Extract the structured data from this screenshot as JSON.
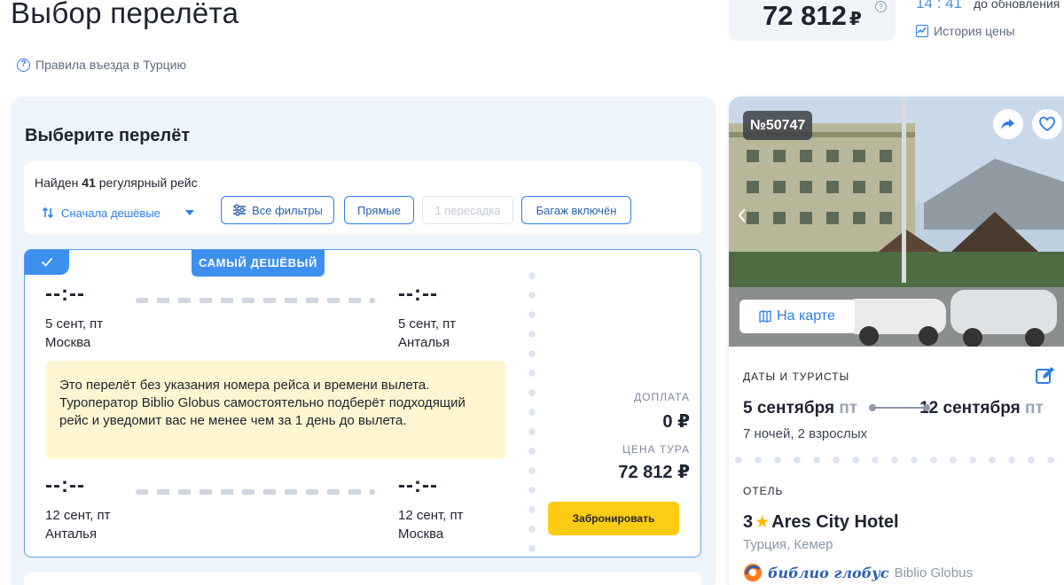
{
  "header": {
    "title": "Выбор перелёта",
    "entry_rules": "Правила въезда в Турцию",
    "price": "72 812",
    "currency": "₽",
    "help": "?",
    "timer": "14 : 41",
    "timer_label": "до обновления",
    "price_history": "История цены"
  },
  "flights": {
    "section_title": "Выберите перелёт",
    "found_prefix": "Найден",
    "found_count": "41",
    "found_suffix": "регулярный рейс",
    "sort_label": "Сначала дешёвые",
    "filters": [
      {
        "label": "Все фильтры",
        "disabled": false
      },
      {
        "label": "Прямые",
        "disabled": false
      },
      {
        "label": "1 пересадка",
        "disabled": true
      },
      {
        "label": "Багаж включён",
        "disabled": false
      }
    ],
    "card": {
      "badge": "САМЫЙ ДЕШЁВЫЙ",
      "outbound": {
        "dep_time": "--:--",
        "dep_date": "5 сент, пт",
        "dep_city": "Москва",
        "arr_time": "--:--",
        "arr_date": "5 сент, пт",
        "arr_city": "Анталья"
      },
      "notice": "Это перелёт без указания номера рейса и времени вылета. Туроператор Biblio Globus самостоятельно подберёт подходящий рейс и уведомит вас не менее чем за 1 день до вылета.",
      "return": {
        "dep_time": "--:--",
        "dep_date": "12 сент, пт",
        "dep_city": "Анталья",
        "arr_time": "--:--",
        "arr_date": "12 сент, пт",
        "arr_city": "Москва"
      },
      "surcharge_label": "ДОПЛАТА",
      "surcharge_value": "0 ₽",
      "tour_price_label": "ЦЕНА ТУРА",
      "tour_price_value": "72 812 ₽",
      "book_button": "Забронировать"
    }
  },
  "hotel": {
    "tour_number": "№50747",
    "map_button": "На карте",
    "dates_label": "ДАТЫ И ТУРИСТЫ",
    "date_from": "5 сентября",
    "date_from_dow": "пт",
    "date_to": "12 сентября",
    "date_to_dow": "пт",
    "nights": "7 ночей, 2 взрослых",
    "hotel_label": "ОТЕЛЬ",
    "stars": "3",
    "name": "Ares City Hotel",
    "location": "Турция,  Кемер",
    "operator_logo": "библио глобус",
    "operator_name": "Biblio Globus"
  },
  "colors": {
    "accent": "#2b7de9",
    "badge": "#3d8ff0",
    "book_button": "#ffcc14",
    "notice_bg": "#fff5d0"
  }
}
